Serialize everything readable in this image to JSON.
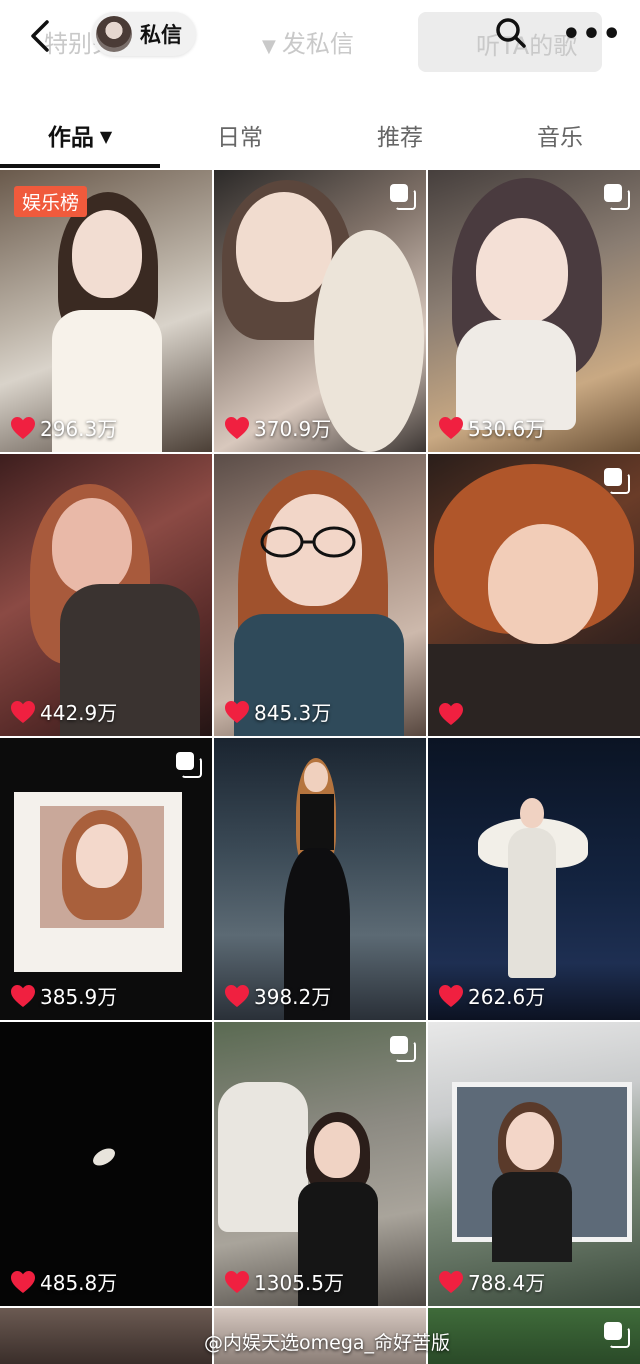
{
  "header": {
    "ghost_left": "特别关注",
    "ghost_mid": "发私信",
    "ghost_right": "听TA的歌",
    "chip_label": "私信",
    "icons": [
      "back-arrow-icon",
      "avatar",
      "search-icon",
      "more-icon"
    ]
  },
  "tabs": [
    {
      "label": "作品",
      "active": true
    },
    {
      "label": "日常",
      "active": false
    },
    {
      "label": "推荐",
      "active": false
    },
    {
      "label": "音乐",
      "active": false
    }
  ],
  "posts": [
    {
      "likes": "296.3万",
      "badge": "娱乐榜",
      "multi": false
    },
    {
      "likes": "370.9万",
      "multi": true
    },
    {
      "likes": "530.6万",
      "multi": true
    },
    {
      "likes": "442.9万",
      "multi": false
    },
    {
      "likes": "845.3万",
      "multi": false
    },
    {
      "likes": "",
      "multi": true
    },
    {
      "likes": "385.9万",
      "multi": true
    },
    {
      "likes": "398.2万",
      "multi": false
    },
    {
      "likes": "262.6万",
      "multi": false
    },
    {
      "likes": "485.8万",
      "multi": false
    },
    {
      "likes": "1305.5万",
      "multi": true
    },
    {
      "likes": "788.4万",
      "multi": false
    }
  ],
  "watermark": "@内娱天选omega_命好苦版",
  "colors": {
    "accent": "#f02040",
    "badge": "#f05a3c",
    "active_tab": "#111111"
  }
}
